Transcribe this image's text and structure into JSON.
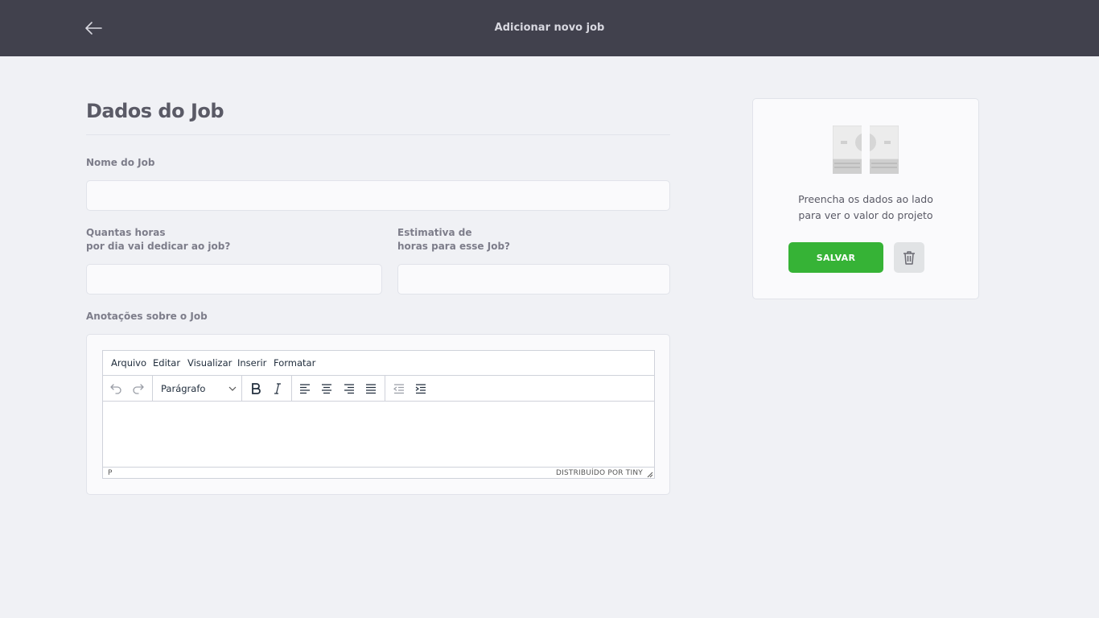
{
  "header": {
    "title": "Adicionar novo job",
    "back_icon": "arrow-left-icon"
  },
  "form": {
    "section_title": "Dados do Job",
    "name_label": "Nome do Job",
    "hours_per_day_label_line1": "Quantas horas",
    "hours_per_day_label_line2": "por dia vai dedicar ao job?",
    "total_hours_label_line1": "Estimativa de",
    "total_hours_label_line2": "horas para esse Job?",
    "notes_label": "Anotações sobre o Job"
  },
  "editor": {
    "menus": [
      "Arquivo",
      "Editar",
      "Visualizar",
      "Inserir",
      "Formatar"
    ],
    "format_select_value": "Parágrafo",
    "status_path": "P",
    "status_brand": "DISTRIBUÍDO POR TINY"
  },
  "summary": {
    "text_line1": "Preencha os dados ao lado",
    "text_line2": "para ver o valor do projeto",
    "save_label": "SALVAR",
    "money_icon": "money-icon",
    "delete_icon": "trash-icon"
  },
  "colors": {
    "header_bg": "#41414d",
    "page_bg": "#f0f1f5",
    "save_green": "#36b336"
  }
}
